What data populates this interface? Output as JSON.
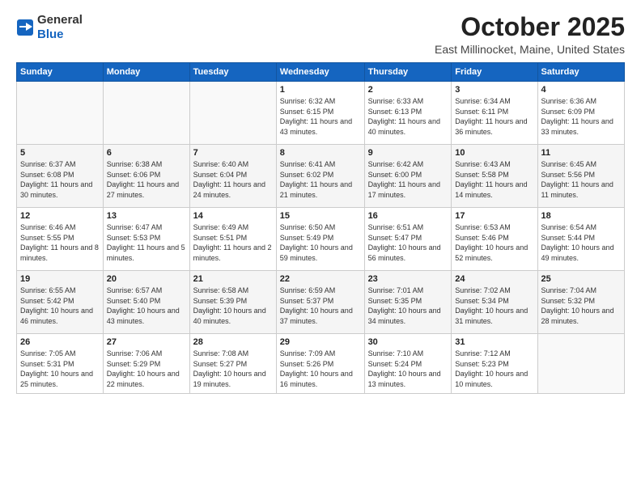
{
  "header": {
    "logo_general": "General",
    "logo_blue": "Blue",
    "month": "October 2025",
    "location": "East Millinocket, Maine, United States"
  },
  "weekdays": [
    "Sunday",
    "Monday",
    "Tuesday",
    "Wednesday",
    "Thursday",
    "Friday",
    "Saturday"
  ],
  "weeks": [
    [
      {
        "day": "",
        "sunrise": "",
        "sunset": "",
        "daylight": ""
      },
      {
        "day": "",
        "sunrise": "",
        "sunset": "",
        "daylight": ""
      },
      {
        "day": "",
        "sunrise": "",
        "sunset": "",
        "daylight": ""
      },
      {
        "day": "1",
        "sunrise": "Sunrise: 6:32 AM",
        "sunset": "Sunset: 6:15 PM",
        "daylight": "Daylight: 11 hours and 43 minutes."
      },
      {
        "day": "2",
        "sunrise": "Sunrise: 6:33 AM",
        "sunset": "Sunset: 6:13 PM",
        "daylight": "Daylight: 11 hours and 40 minutes."
      },
      {
        "day": "3",
        "sunrise": "Sunrise: 6:34 AM",
        "sunset": "Sunset: 6:11 PM",
        "daylight": "Daylight: 11 hours and 36 minutes."
      },
      {
        "day": "4",
        "sunrise": "Sunrise: 6:36 AM",
        "sunset": "Sunset: 6:09 PM",
        "daylight": "Daylight: 11 hours and 33 minutes."
      }
    ],
    [
      {
        "day": "5",
        "sunrise": "Sunrise: 6:37 AM",
        "sunset": "Sunset: 6:08 PM",
        "daylight": "Daylight: 11 hours and 30 minutes."
      },
      {
        "day": "6",
        "sunrise": "Sunrise: 6:38 AM",
        "sunset": "Sunset: 6:06 PM",
        "daylight": "Daylight: 11 hours and 27 minutes."
      },
      {
        "day": "7",
        "sunrise": "Sunrise: 6:40 AM",
        "sunset": "Sunset: 6:04 PM",
        "daylight": "Daylight: 11 hours and 24 minutes."
      },
      {
        "day": "8",
        "sunrise": "Sunrise: 6:41 AM",
        "sunset": "Sunset: 6:02 PM",
        "daylight": "Daylight: 11 hours and 21 minutes."
      },
      {
        "day": "9",
        "sunrise": "Sunrise: 6:42 AM",
        "sunset": "Sunset: 6:00 PM",
        "daylight": "Daylight: 11 hours and 17 minutes."
      },
      {
        "day": "10",
        "sunrise": "Sunrise: 6:43 AM",
        "sunset": "Sunset: 5:58 PM",
        "daylight": "Daylight: 11 hours and 14 minutes."
      },
      {
        "day": "11",
        "sunrise": "Sunrise: 6:45 AM",
        "sunset": "Sunset: 5:56 PM",
        "daylight": "Daylight: 11 hours and 11 minutes."
      }
    ],
    [
      {
        "day": "12",
        "sunrise": "Sunrise: 6:46 AM",
        "sunset": "Sunset: 5:55 PM",
        "daylight": "Daylight: 11 hours and 8 minutes."
      },
      {
        "day": "13",
        "sunrise": "Sunrise: 6:47 AM",
        "sunset": "Sunset: 5:53 PM",
        "daylight": "Daylight: 11 hours and 5 minutes."
      },
      {
        "day": "14",
        "sunrise": "Sunrise: 6:49 AM",
        "sunset": "Sunset: 5:51 PM",
        "daylight": "Daylight: 11 hours and 2 minutes."
      },
      {
        "day": "15",
        "sunrise": "Sunrise: 6:50 AM",
        "sunset": "Sunset: 5:49 PM",
        "daylight": "Daylight: 10 hours and 59 minutes."
      },
      {
        "day": "16",
        "sunrise": "Sunrise: 6:51 AM",
        "sunset": "Sunset: 5:47 PM",
        "daylight": "Daylight: 10 hours and 56 minutes."
      },
      {
        "day": "17",
        "sunrise": "Sunrise: 6:53 AM",
        "sunset": "Sunset: 5:46 PM",
        "daylight": "Daylight: 10 hours and 52 minutes."
      },
      {
        "day": "18",
        "sunrise": "Sunrise: 6:54 AM",
        "sunset": "Sunset: 5:44 PM",
        "daylight": "Daylight: 10 hours and 49 minutes."
      }
    ],
    [
      {
        "day": "19",
        "sunrise": "Sunrise: 6:55 AM",
        "sunset": "Sunset: 5:42 PM",
        "daylight": "Daylight: 10 hours and 46 minutes."
      },
      {
        "day": "20",
        "sunrise": "Sunrise: 6:57 AM",
        "sunset": "Sunset: 5:40 PM",
        "daylight": "Daylight: 10 hours and 43 minutes."
      },
      {
        "day": "21",
        "sunrise": "Sunrise: 6:58 AM",
        "sunset": "Sunset: 5:39 PM",
        "daylight": "Daylight: 10 hours and 40 minutes."
      },
      {
        "day": "22",
        "sunrise": "Sunrise: 6:59 AM",
        "sunset": "Sunset: 5:37 PM",
        "daylight": "Daylight: 10 hours and 37 minutes."
      },
      {
        "day": "23",
        "sunrise": "Sunrise: 7:01 AM",
        "sunset": "Sunset: 5:35 PM",
        "daylight": "Daylight: 10 hours and 34 minutes."
      },
      {
        "day": "24",
        "sunrise": "Sunrise: 7:02 AM",
        "sunset": "Sunset: 5:34 PM",
        "daylight": "Daylight: 10 hours and 31 minutes."
      },
      {
        "day": "25",
        "sunrise": "Sunrise: 7:04 AM",
        "sunset": "Sunset: 5:32 PM",
        "daylight": "Daylight: 10 hours and 28 minutes."
      }
    ],
    [
      {
        "day": "26",
        "sunrise": "Sunrise: 7:05 AM",
        "sunset": "Sunset: 5:31 PM",
        "daylight": "Daylight: 10 hours and 25 minutes."
      },
      {
        "day": "27",
        "sunrise": "Sunrise: 7:06 AM",
        "sunset": "Sunset: 5:29 PM",
        "daylight": "Daylight: 10 hours and 22 minutes."
      },
      {
        "day": "28",
        "sunrise": "Sunrise: 7:08 AM",
        "sunset": "Sunset: 5:27 PM",
        "daylight": "Daylight: 10 hours and 19 minutes."
      },
      {
        "day": "29",
        "sunrise": "Sunrise: 7:09 AM",
        "sunset": "Sunset: 5:26 PM",
        "daylight": "Daylight: 10 hours and 16 minutes."
      },
      {
        "day": "30",
        "sunrise": "Sunrise: 7:10 AM",
        "sunset": "Sunset: 5:24 PM",
        "daylight": "Daylight: 10 hours and 13 minutes."
      },
      {
        "day": "31",
        "sunrise": "Sunrise: 7:12 AM",
        "sunset": "Sunset: 5:23 PM",
        "daylight": "Daylight: 10 hours and 10 minutes."
      },
      {
        "day": "",
        "sunrise": "",
        "sunset": "",
        "daylight": ""
      }
    ]
  ]
}
